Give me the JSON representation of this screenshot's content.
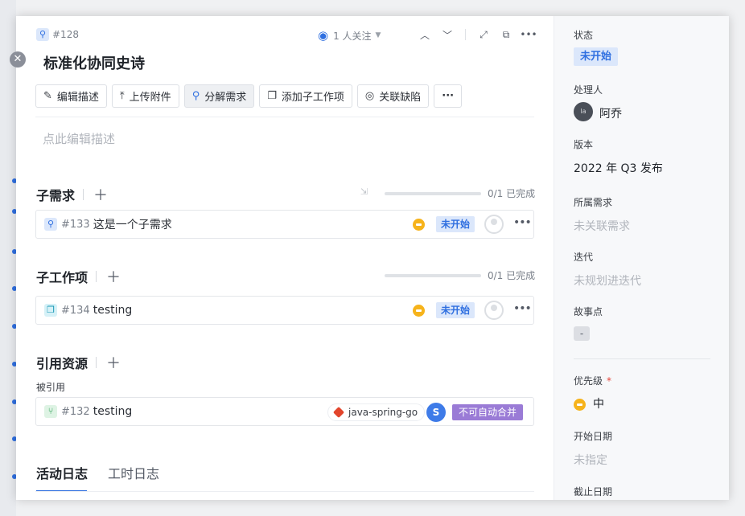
{
  "header": {
    "issue_number": "#128",
    "watchers": "1 人关注",
    "title": "标准化协同史诗"
  },
  "toolbar": {
    "edit_desc": "编辑描述",
    "upload": "上传附件",
    "split": "分解需求",
    "add_child": "添加子工作项",
    "link_bug": "关联缺陷",
    "more": "···"
  },
  "description_placeholder": "点此编辑描述",
  "sub_requirements": {
    "title": "子需求",
    "progress_text": "0/1 已完成",
    "progress": 0,
    "items": [
      {
        "number": "#133",
        "title": "这是一个子需求",
        "status": "未开始"
      }
    ]
  },
  "sub_workitems": {
    "title": "子工作项",
    "progress_text": "0/1 已完成",
    "progress": 0,
    "items": [
      {
        "number": "#134",
        "title": "testing",
        "status": "未开始"
      }
    ]
  },
  "references": {
    "title": "引用资源",
    "sub_label": "被引用",
    "items": [
      {
        "number": "#132",
        "title": "testing",
        "branch": "java-spring-go",
        "avatar": "S",
        "merge_status": "不可自动合并"
      }
    ]
  },
  "tabs": [
    "活动日志",
    "工时日志"
  ],
  "sidebar": {
    "status_label": "状态",
    "status_value": "未开始",
    "assignee_label": "处理人",
    "assignee_value": "阿乔",
    "version_label": "版本",
    "version_value": "2022 年 Q3 发布",
    "parent_label": "所属需求",
    "parent_value": "未关联需求",
    "iteration_label": "迭代",
    "iteration_value": "未规划进迭代",
    "story_points_label": "故事点",
    "story_points_value": "-",
    "priority_label": "优先级",
    "priority_required": "*",
    "priority_value": "中",
    "start_date_label": "开始日期",
    "start_date_value": "未指定",
    "due_date_label": "截止日期"
  },
  "colors": {
    "accent": "#2f6fe0",
    "priority_medium": "#f6b31b",
    "merge_tag": "#9a7bd6",
    "branch_icon": "#e2452c"
  }
}
